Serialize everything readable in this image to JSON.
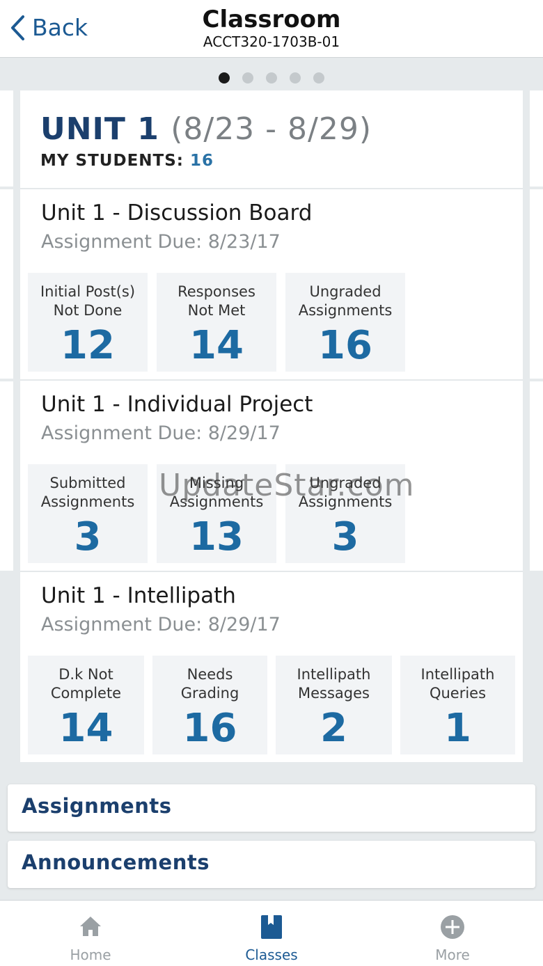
{
  "header": {
    "back_label": "Back",
    "title": "Classroom",
    "subtitle": "ACCT320-1703B-01"
  },
  "pager": {
    "count": 5,
    "active": 0
  },
  "unit": {
    "title": "UNIT 1",
    "dates": "(8/23 - 8/29)",
    "students_label": "MY STUDENTS:",
    "students_count": "16"
  },
  "sections": [
    {
      "title": "Unit 1 - Discussion Board",
      "due": "Assignment Due: 8/23/17",
      "tiles": [
        {
          "label1": "Initial Post(s)",
          "label2": "Not Done",
          "value": "12"
        },
        {
          "label1": "Responses",
          "label2": "Not Met",
          "value": "14"
        },
        {
          "label1": "Ungraded",
          "label2": "Assignments",
          "value": "16"
        }
      ]
    },
    {
      "title": "Unit 1 - Individual Project",
      "due": "Assignment Due: 8/29/17",
      "tiles": [
        {
          "label1": "Submitted",
          "label2": "Assignments",
          "value": "3"
        },
        {
          "label1": "Missing",
          "label2": "Assignments",
          "value": "13"
        },
        {
          "label1": "Ungraded",
          "label2": "Assignments",
          "value": "3"
        }
      ]
    },
    {
      "title": "Unit 1 - Intellipath",
      "due": "Assignment Due: 8/29/17",
      "tiles": [
        {
          "label1": "D.k Not",
          "label2": "Complete",
          "value": "14"
        },
        {
          "label1": "Needs",
          "label2": "Grading",
          "value": "16"
        },
        {
          "label1": "Intellipath",
          "label2": "Messages",
          "value": "2"
        },
        {
          "label1": "Intellipath",
          "label2": "Queries",
          "value": "1"
        }
      ]
    }
  ],
  "links": {
    "assignments": "Assignments",
    "announcements": "Announcements"
  },
  "tabs": {
    "home": "Home",
    "classes": "Classes",
    "more": "More",
    "active": "classes"
  },
  "watermark": "UpdateStar.com",
  "colors": {
    "accent": "#1d6aa2",
    "navy": "#1b3f6d",
    "muted": "#9aa0a4"
  }
}
